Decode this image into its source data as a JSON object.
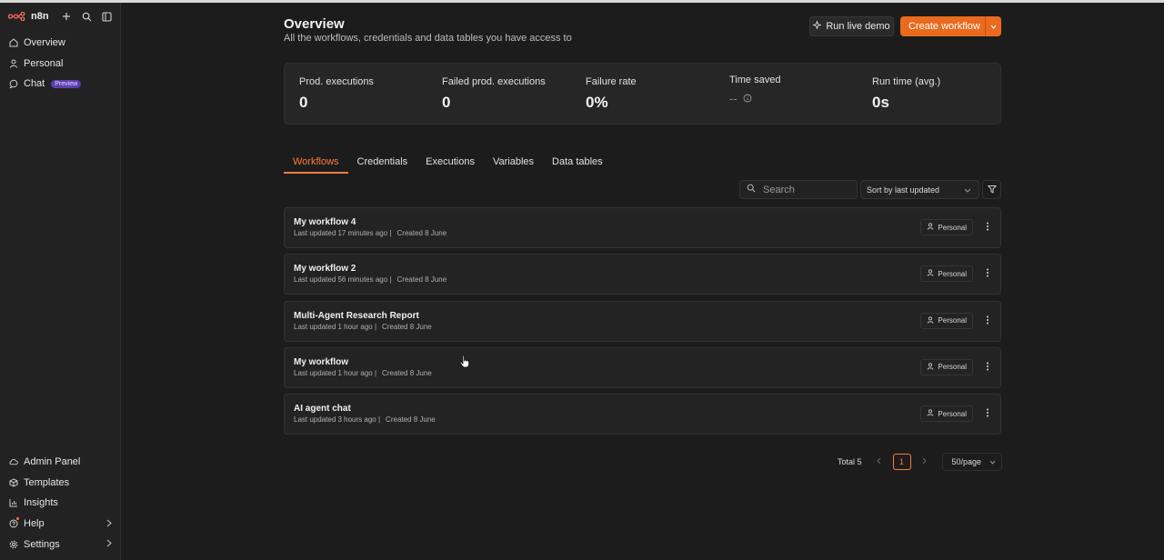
{
  "app": {
    "name": "n8n"
  },
  "colors": {
    "accent": "#ea6a1e",
    "tab_active": "#ff7a3d",
    "background": "#1c1c1c",
    "sidebar": "#222222"
  },
  "sidebar": {
    "top_icons": [
      "plus-icon",
      "search-icon",
      "sidebar-toggle-icon"
    ],
    "primary": [
      {
        "label": "Overview",
        "icon": "home-icon"
      },
      {
        "label": "Personal",
        "icon": "user-icon"
      },
      {
        "label": "Chat",
        "icon": "chat-icon",
        "badge": "Preview"
      }
    ],
    "bottom": [
      {
        "label": "Admin Panel",
        "icon": "cloud-icon"
      },
      {
        "label": "Templates",
        "icon": "box-icon"
      },
      {
        "label": "Insights",
        "icon": "bar-chart-icon"
      },
      {
        "label": "Help",
        "icon": "help-icon"
      },
      {
        "label": "Settings",
        "icon": "gear-icon"
      }
    ]
  },
  "header": {
    "title": "Overview",
    "subtitle": "All the workflows, credentials and data tables you have access to",
    "demo_button": "Run live demo",
    "create_button": "Create workflow"
  },
  "stats": [
    {
      "label": "Prod. executions",
      "value": "0"
    },
    {
      "label": "Failed prod. executions",
      "value": "0"
    },
    {
      "label": "Failure rate",
      "value": "0%"
    },
    {
      "label": "Time saved",
      "value": "--"
    },
    {
      "label": "Run time (avg.)",
      "value": "0s"
    }
  ],
  "tabs": [
    "Workflows",
    "Credentials",
    "Executions",
    "Variables",
    "Data tables"
  ],
  "active_tab": "Workflows",
  "search": {
    "placeholder": "Search"
  },
  "sort": {
    "value": "Sort by last updated"
  },
  "workflows": [
    {
      "name": "My workflow 4",
      "updated": "Last updated 17 minutes ago |",
      "created": "Created 8 June",
      "owner": "Personal"
    },
    {
      "name": "My workflow 2",
      "updated": "Last updated 56 minutes ago |",
      "created": "Created 8 June",
      "owner": "Personal"
    },
    {
      "name": "Multi-Agent Research Report",
      "updated": "Last updated 1 hour ago |",
      "created": "Created 8 June",
      "owner": "Personal"
    },
    {
      "name": "My workflow",
      "updated": "Last updated 1 hour ago |",
      "created": "Created 8 June",
      "owner": "Personal"
    },
    {
      "name": "AI agent chat",
      "updated": "Last updated 3 hours ago |",
      "created": "Created 8 June",
      "owner": "Personal"
    }
  ],
  "pagination": {
    "total": "Total 5",
    "current_page": "1",
    "page_size": "50/page"
  }
}
